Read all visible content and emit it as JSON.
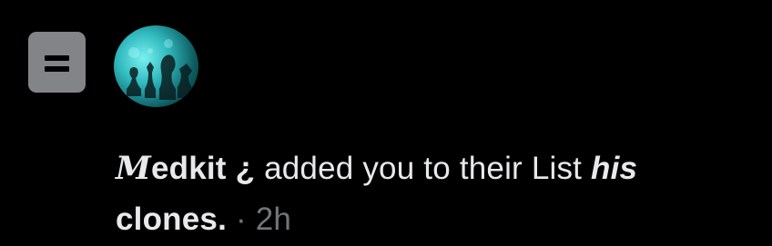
{
  "notification": {
    "type_icon": "list-icon",
    "avatar_icon": "chess-pieces-avatar",
    "actor_name_initial": "M",
    "actor_name_rest": "edkit ¿",
    "action_text": "added you to their List",
    "list_name_italic": "his",
    "list_name_rest": "clones.",
    "separator": "·",
    "timestamp": "2h"
  },
  "colors": {
    "background": "#000000",
    "text_primary": "#e7e9ea",
    "text_secondary": "#71767b",
    "list_icon_bg": "#828488",
    "avatar_accent": "#2fb8bd"
  }
}
